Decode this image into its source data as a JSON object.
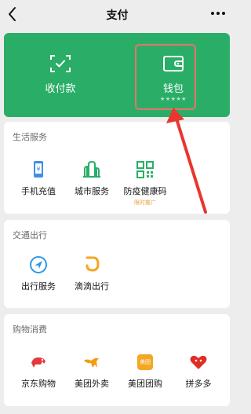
{
  "header": {
    "title": "支付"
  },
  "payment": {
    "collect_label": "收付款",
    "wallet_label": "钱包",
    "wallet_stars": "★★★★★"
  },
  "sections": {
    "life": {
      "title": "生活服务",
      "items": [
        {
          "label": "手机充值"
        },
        {
          "label": "城市服务"
        },
        {
          "label": "防疫健康码",
          "badge": "限时推广"
        }
      ]
    },
    "transport": {
      "title": "交通出行",
      "items": [
        {
          "label": "出行服务"
        },
        {
          "label": "滴滴出行"
        }
      ]
    },
    "shopping": {
      "title": "购物消费",
      "items": [
        {
          "label": "京东购物"
        },
        {
          "label": "美团外卖"
        },
        {
          "label": "美团团购",
          "icon_text": "美团"
        },
        {
          "label": "拼多多"
        }
      ]
    }
  },
  "colors": {
    "green": "#2aae67",
    "annotation_red": "#e8372e",
    "badge": "#e6a23c"
  }
}
